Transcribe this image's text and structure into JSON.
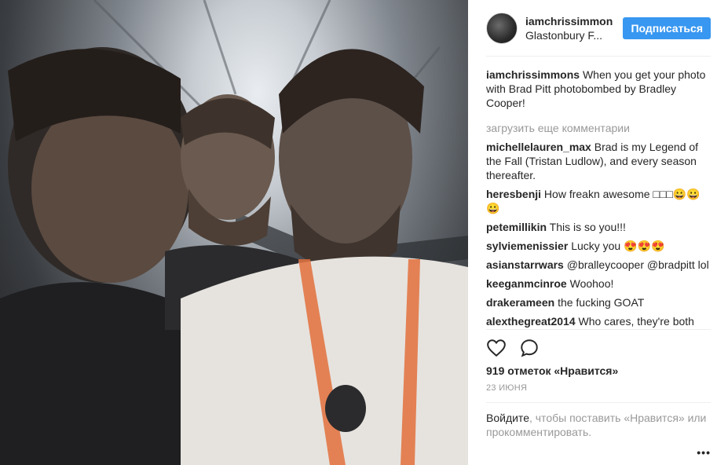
{
  "header": {
    "username": "iamchrissimmons",
    "location": "Glastonbury F...",
    "follow_label": "Подписаться"
  },
  "caption": {
    "username": "iamchrissimmons",
    "text": "When you get your photo with Brad Pitt photobombed by Bradley Cooper!"
  },
  "load_more_label": "загрузить еще комментарии",
  "comments": [
    {
      "user": "michellelauren_max",
      "text": "Brad is my Legend of the Fall (Tristan Ludlow), and every season thereafter."
    },
    {
      "user": "heresbenji",
      "text": "How freakn awesome □□□😀😀😀"
    },
    {
      "user": "petemillikin",
      "text": "This is so you!!!"
    },
    {
      "user": "sylviemenissier",
      "text": "Lucky you 😍😍😍"
    },
    {
      "user": "asianstarrwars",
      "text": "@bralleycooper @bradpitt lol"
    },
    {
      "user": "keeganmcinroe",
      "text": "Woohoo!"
    },
    {
      "user": "drakerameen",
      "text": "the fucking GOAT"
    },
    {
      "user": "alexthegreat2014",
      "text": "Who cares, they're both"
    }
  ],
  "actions": {
    "like_icon": "heart-icon",
    "comment_icon": "comment-bubble-icon"
  },
  "likes_text": "919 отметок «Нравится»",
  "date_text": "23 ИЮНЯ",
  "login": {
    "link": "Войдите",
    "rest": ", чтобы поставить «Нравится» или прокомментировать."
  },
  "more_label": "•••"
}
